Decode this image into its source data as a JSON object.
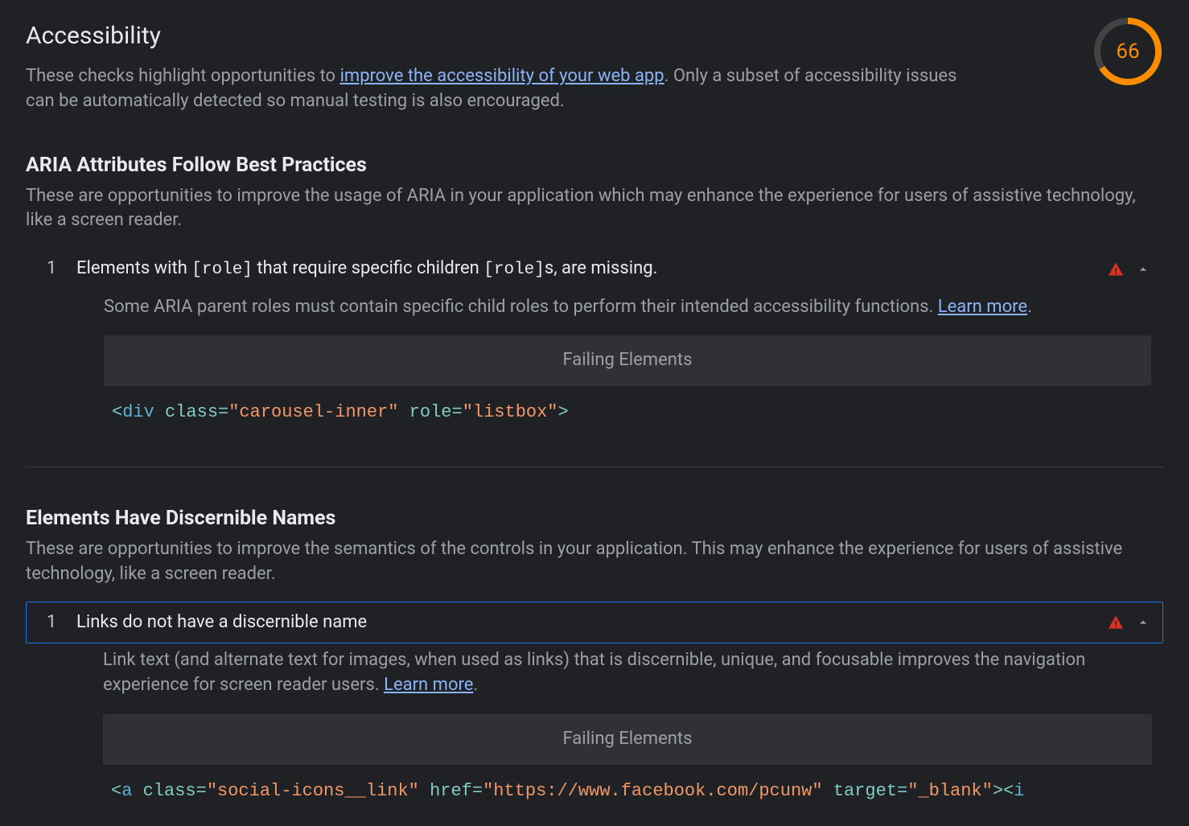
{
  "header": {
    "title": "Accessibility",
    "intro_before": "These checks highlight opportunities to ",
    "intro_link": "improve the accessibility of your web app",
    "intro_after": ". Only a subset of accessibility issues can be automatically detected so manual testing is also encouraged."
  },
  "score": {
    "value": 66,
    "color": "#fb8c00"
  },
  "sections": [
    {
      "title": "ARIA Attributes Follow Best Practices",
      "desc": "These are opportunities to improve the usage of ARIA in your application which may enhance the experience for users of assistive technology, like a screen reader.",
      "audit": {
        "count": "1",
        "title_before": "Elements with ",
        "title_code1": "[role]",
        "title_mid": " that require specific children ",
        "title_code2": "[role]",
        "title_after": "s, are missing.",
        "desc_before": "Some ARIA parent roles must contain specific child roles to perform their intended accessibility functions. ",
        "learn_more": "Learn more",
        "desc_after": ".",
        "failing_header": "Failing Elements",
        "code": {
          "tag": "div",
          "attrs": [
            {
              "name": "class",
              "value": "carousel-inner"
            },
            {
              "name": "role",
              "value": "listbox"
            }
          ]
        }
      }
    },
    {
      "title": "Elements Have Discernible Names",
      "desc": "These are opportunities to improve the semantics of the controls in your application. This may enhance the experience for users of assistive technology, like a screen reader.",
      "audit": {
        "count": "1",
        "title_plain": "Links do not have a discernible name",
        "desc_before": "Link text (and alternate text for images, when used as links) that is discernible, unique, and focusable improves the navigation experience for screen reader users. ",
        "learn_more": "Learn more",
        "desc_after": ".",
        "failing_header": "Failing Elements",
        "code": {
          "tag": "a",
          "attrs": [
            {
              "name": "class",
              "value": "social-icons__link"
            },
            {
              "name": "href",
              "value": "https://www.facebook.com/pcunw"
            },
            {
              "name": "target",
              "value": "_blank"
            }
          ],
          "trailing_open": "i"
        }
      }
    }
  ]
}
